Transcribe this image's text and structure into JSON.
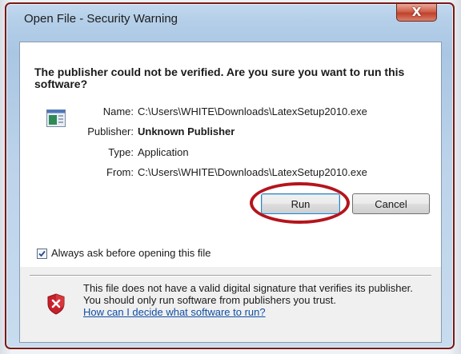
{
  "window": {
    "title": "Open File - Security Warning",
    "close_label": "X"
  },
  "dialog": {
    "heading": "The publisher could not be verified.  Are you sure you want to run this software?",
    "fields": {
      "name_label": "Name:",
      "name_value": "C:\\Users\\WHITE\\Downloads\\LatexSetup2010.exe",
      "publisher_label": "Publisher:",
      "publisher_value": "Unknown Publisher",
      "type_label": "Type:",
      "type_value": "Application",
      "from_label": "From:",
      "from_value": "C:\\Users\\WHITE\\Downloads\\LatexSetup2010.exe"
    },
    "buttons": {
      "run_label": "Run",
      "cancel_label": "Cancel"
    },
    "checkbox": {
      "label": "Always ask before opening this file",
      "checked": true
    },
    "warning": {
      "text": "This file does not have a valid digital signature that verifies its publisher.  You should only run software from publishers you trust.",
      "link": "How can I decide what software to run?"
    }
  },
  "colors": {
    "annotation_circle": "#b5141c",
    "link": "#0f4fa3",
    "shield_red": "#c8202a"
  },
  "icons": {
    "app": "application-icon",
    "warning": "shield-x-icon",
    "check": "checkmark-icon"
  }
}
